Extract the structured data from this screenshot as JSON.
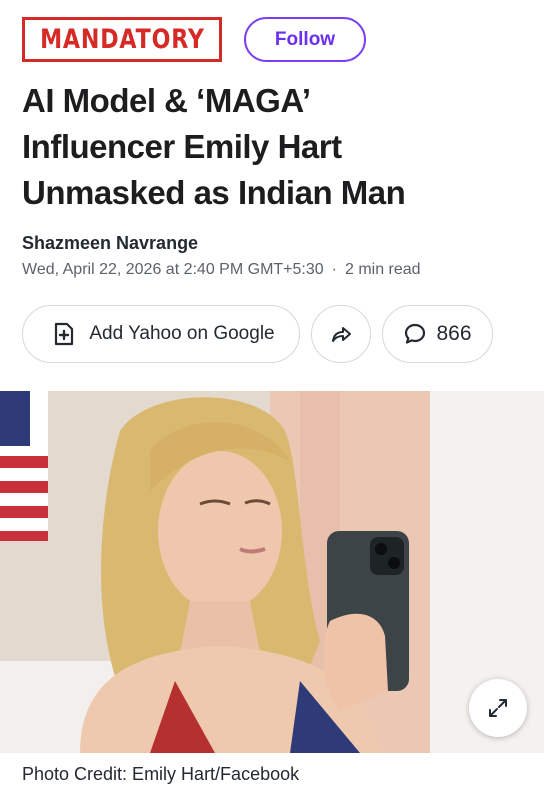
{
  "publisher": {
    "logo_text": "MANDATORY",
    "follow_label": "Follow"
  },
  "article": {
    "headline_lines": [
      "AI Model & ‘MAGA’",
      "Influencer Emily Hart",
      "Unmasked as Indian Man"
    ],
    "author": "Shazmeen Navrange",
    "date": "Wed, April 22, 2026 at 2:40 PM GMT+5:30",
    "separator": "·",
    "read_time": "2 min read"
  },
  "actions": {
    "google_label": "Add Yahoo on Google",
    "comment_count": "866"
  },
  "photo": {
    "credit": "Photo Credit: Emily Hart/Facebook"
  },
  "icons": [
    "add-box-icon",
    "share-arrow-icon",
    "comment-bubble-icon",
    "expand-icon"
  ],
  "colors": {
    "brand_red": "#d62a26",
    "follow_purple": "#6b2ff0",
    "text": "#1d1d1f",
    "meta_gray": "#5b636a"
  }
}
